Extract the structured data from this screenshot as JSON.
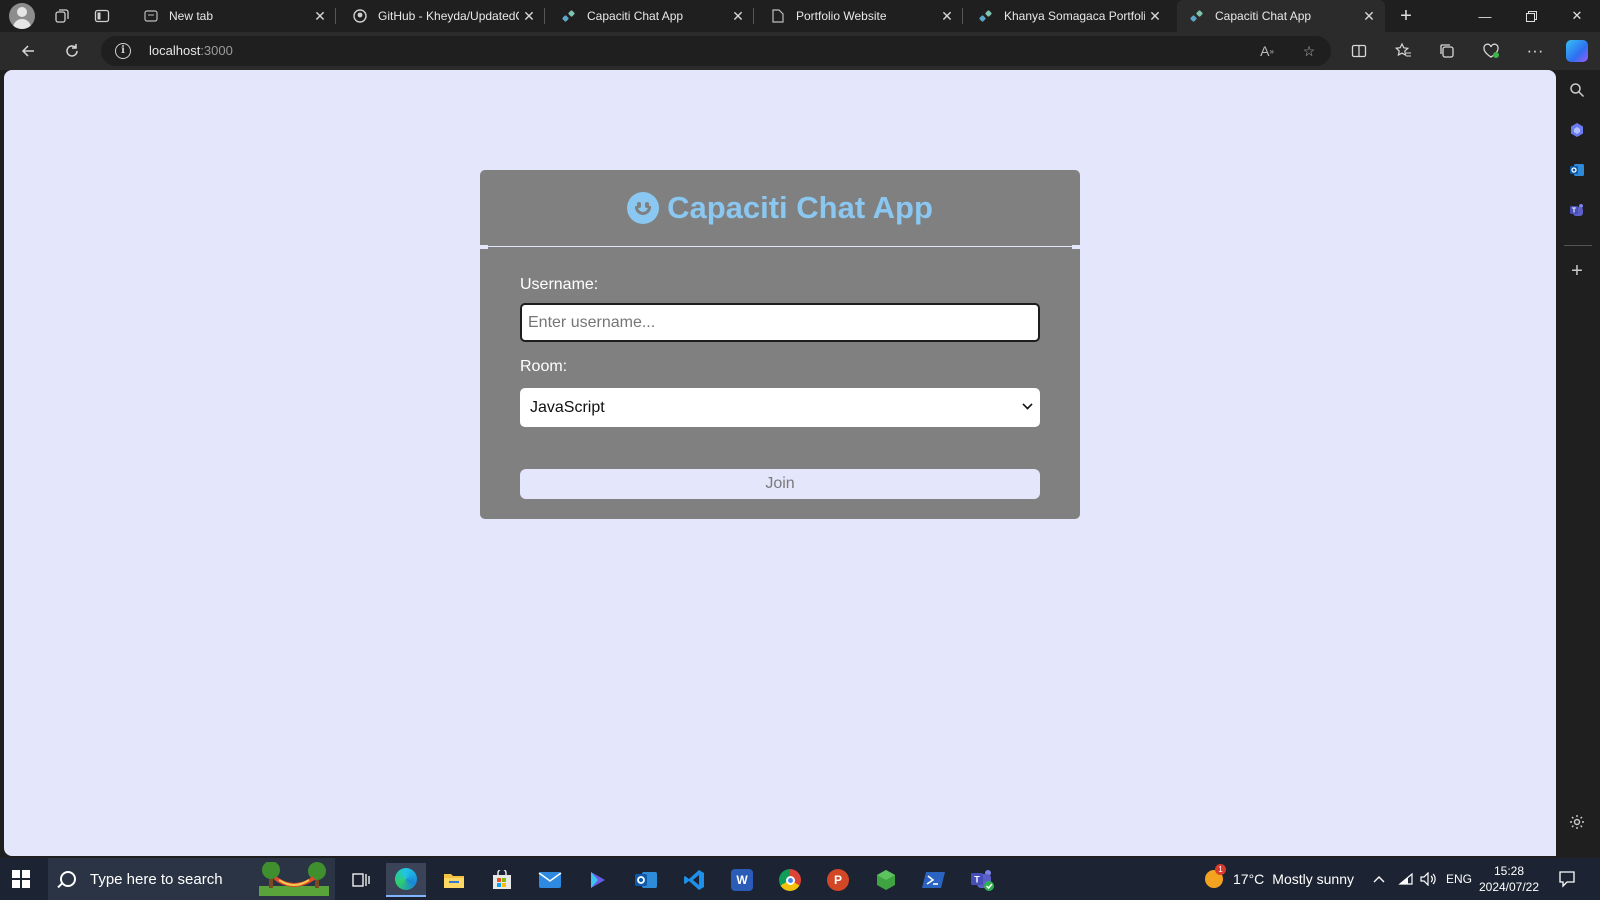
{
  "browser": {
    "tabs": [
      {
        "title": "New tab",
        "favicon": "newtab-icon",
        "active": false
      },
      {
        "title": "GitHub - Kheyda/UpdatedC",
        "favicon": "github-icon",
        "active": false
      },
      {
        "title": "Capaciti Chat App",
        "favicon": "capaciti-logo-icon",
        "active": false
      },
      {
        "title": "Portfolio Website",
        "favicon": "document-icon",
        "active": false
      },
      {
        "title": "Khanya Somagaca Portfolio",
        "favicon": "capaciti-logo-icon",
        "active": false
      },
      {
        "title": "Capaciti Chat App",
        "favicon": "capaciti-logo-icon",
        "active": true
      }
    ],
    "address": {
      "host": "localhost",
      "port": ":3000"
    }
  },
  "page": {
    "title": "Capaciti Chat App",
    "title_icon": "smiley-icon",
    "accent_color": "#8ac7f1",
    "card_color": "#808080",
    "background_color": "#e4e6fc",
    "form": {
      "username_label": "Username:",
      "username_placeholder": "Enter username...",
      "username_value": "",
      "room_label": "Room:",
      "room_selected": "JavaScript",
      "join_label": "Join"
    }
  },
  "taskbar": {
    "search_placeholder": "Type here to search",
    "apps": [
      "task-view-icon",
      "edge-icon",
      "file-explorer-icon",
      "store-icon",
      "mail-icon",
      "copilot-icon",
      "outlook-icon",
      "vscode-icon",
      "word-icon",
      "chrome-icon",
      "powerpoint-icon",
      "nodejs-icon",
      "powershell-icon",
      "teams-icon"
    ],
    "weather": {
      "temp": "17°C",
      "condition": "Mostly sunny",
      "badge": "1"
    },
    "language": "ENG",
    "time": "15:28",
    "date": "2024/07/22"
  }
}
